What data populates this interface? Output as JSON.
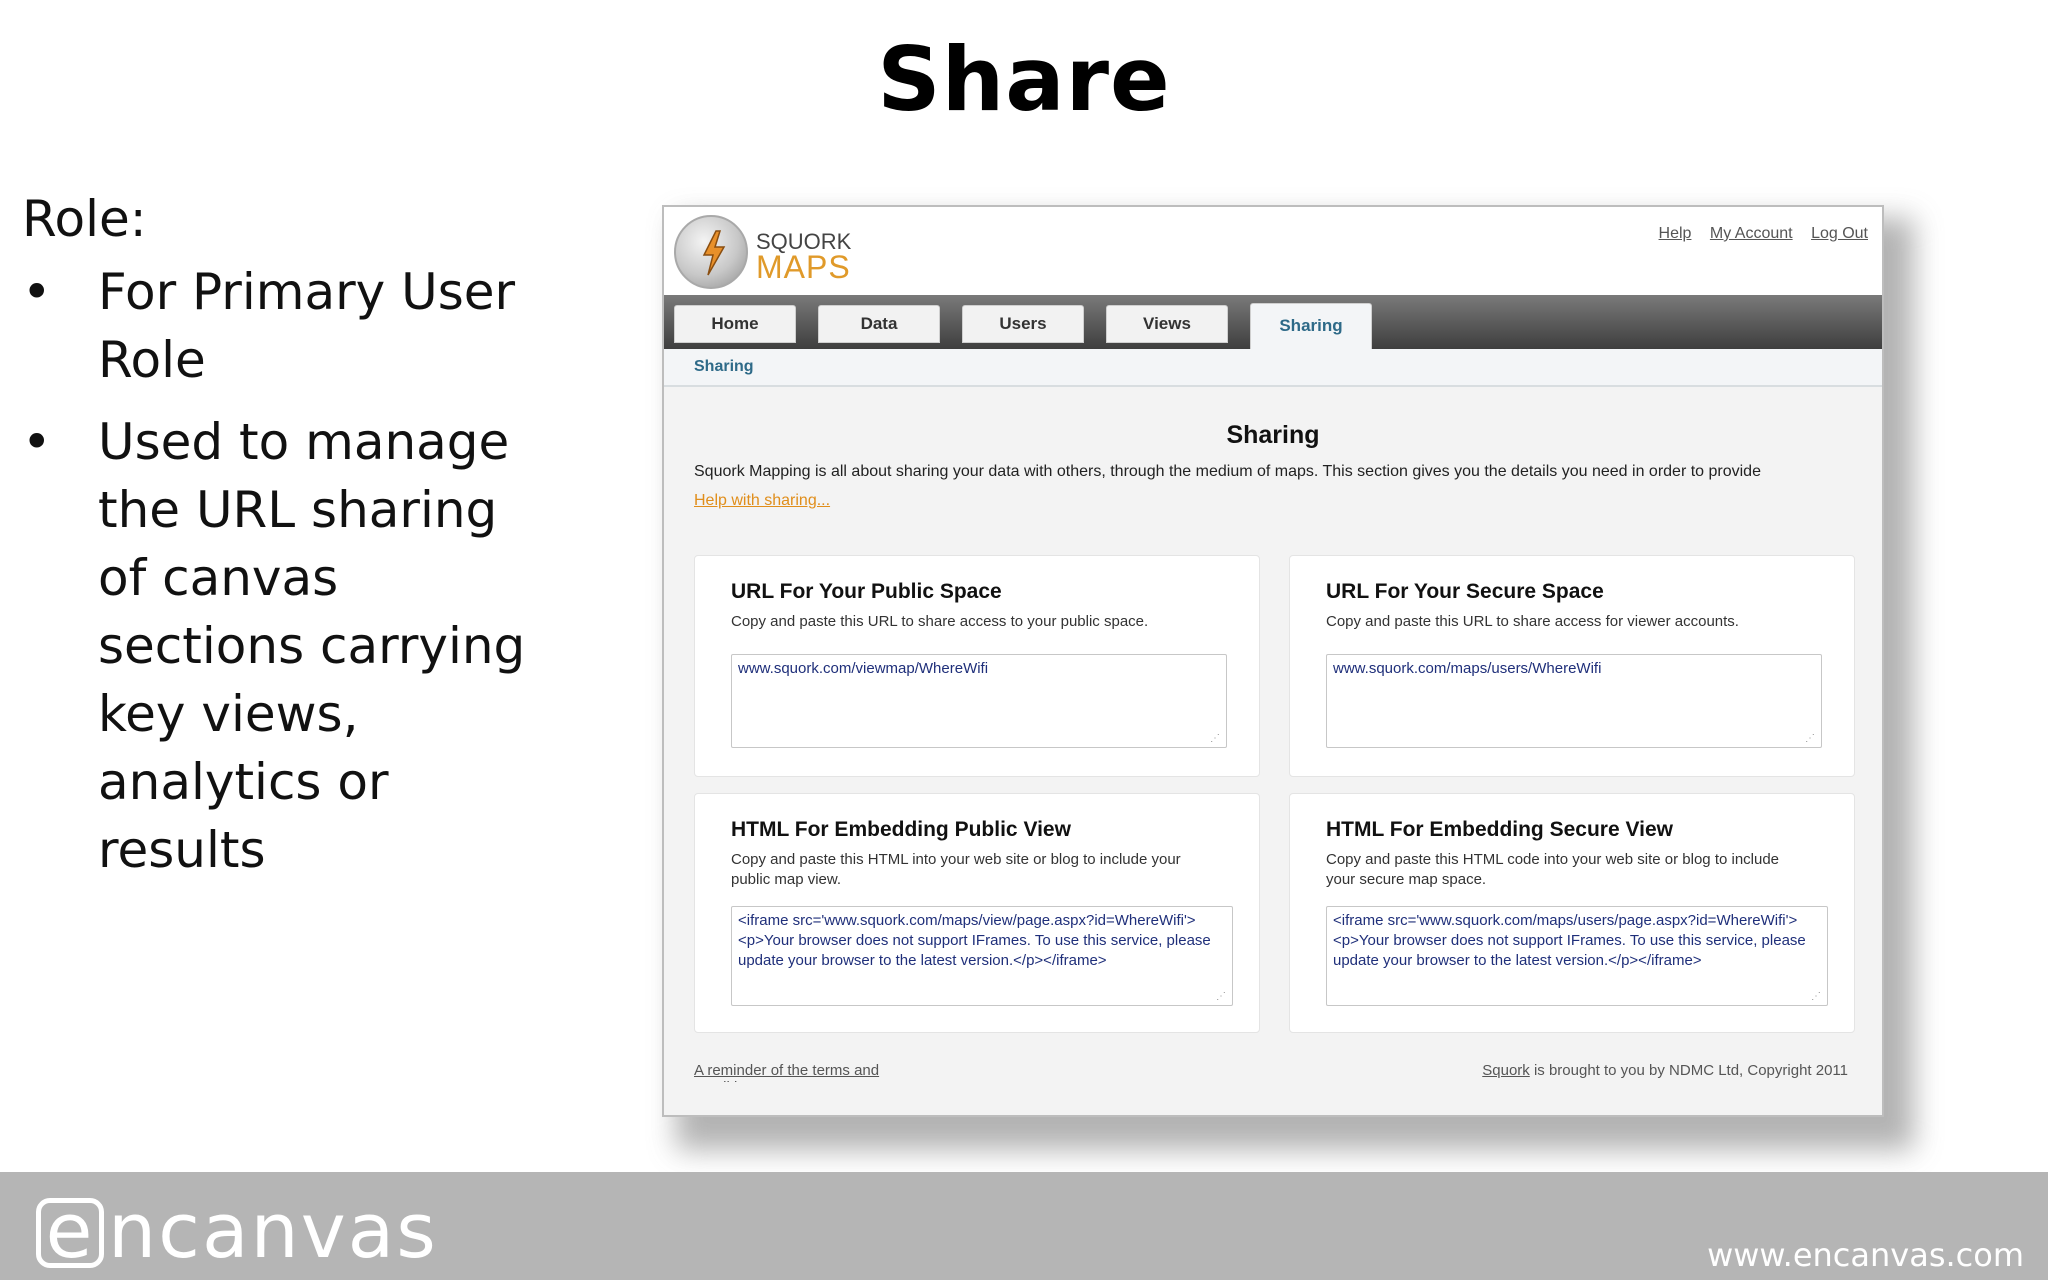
{
  "slide": {
    "title": "Share",
    "role_label": "Role:",
    "bullets": [
      "For Primary User Role",
      "Used to manage the URL sharing of canvas sections carrying key views, analytics or results"
    ],
    "bullet_glyph": "•"
  },
  "app": {
    "logo_top": "SQUORK",
    "logo_bottom": "MAPS",
    "top_links": [
      "Help",
      "My Account",
      "Log Out"
    ],
    "tabs": [
      "Home",
      "Data",
      "Users",
      "Views",
      "Sharing"
    ],
    "active_tab": "Sharing",
    "breadcrumb": "Sharing",
    "page_title": "Sharing",
    "intro": "Squork Mapping is all about sharing your data with others, through the medium of maps. This section gives you the details you need in order to provide",
    "help_link": "Help with sharing...",
    "panels": {
      "public_url": {
        "title": "URL For Your Public Space",
        "desc": "Copy and paste this URL to share access to your public space.",
        "value": "www.squork.com/viewmap/WhereWifi"
      },
      "secure_url": {
        "title": "URL For Your Secure Space",
        "desc": "Copy and paste this URL to share access for viewer accounts.",
        "value": "www.squork.com/maps/users/WhereWifi"
      },
      "public_embed": {
        "title": "HTML For Embedding Public View",
        "desc": "Copy and paste this HTML into your web site or blog to include your public map view.",
        "value": "<iframe src='www.squork.com/maps/view/page.aspx?id=WhereWifi'><p>Your browser does not support IFrames. To use this service, please update your browser to the latest version.</p></iframe>"
      },
      "secure_embed": {
        "title": "HTML For Embedding Secure View",
        "desc": "Copy and paste this HTML code into your web site or blog to include your secure map space.",
        "value": "<iframe src='www.squork.com/maps/users/page.aspx?id=WhereWifi'><p>Your browser does not support IFrames. To use this service, please update your browser to the latest version.</p></iframe>"
      }
    },
    "footer_left": "A reminder of the terms and conditions",
    "footer_brand": "Squork",
    "footer_right": " is brought to you by NDMC Ltd, Copyright 2011"
  },
  "branding": {
    "logo_e": "e",
    "logo_rest": "ncanvas",
    "site": "www.encanvas.com",
    "accent_orange": "#e09a2a",
    "tab_active_color": "#2e6a88"
  }
}
